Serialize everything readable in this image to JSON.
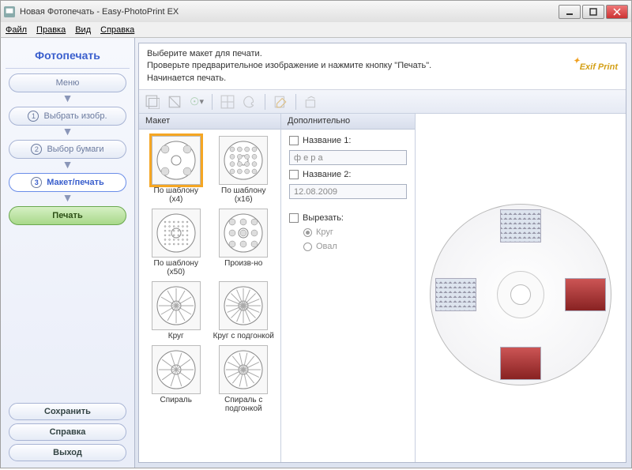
{
  "window": {
    "title": "Новая Фотопечать - Easy-PhotoPrint EX"
  },
  "menu": {
    "file": "Файл",
    "edit": "Правка",
    "view": "Вид",
    "help": "Справка"
  },
  "sidebar": {
    "title": "Фотопечать",
    "steps": {
      "menu": "Меню",
      "select": "Выбрать изобр.",
      "paper": "Выбор бумаги",
      "layout": "Макет/печать"
    },
    "print": "Печать",
    "save": "Сохранить",
    "help": "Справка",
    "exit": "Выход"
  },
  "instructions": {
    "line1": "Выберите макет для печати.",
    "line2": "Проверьте предварительное изображение и нажмите кнопку \"Печать\".",
    "line3": "Начинается печать."
  },
  "brand": "Exif Print",
  "columns": {
    "layout": "Макет",
    "extra": "Дополнительно"
  },
  "layouts": [
    {
      "id": "tmpl4",
      "label": "По шаблону (x4)",
      "selected": true
    },
    {
      "id": "tmpl16",
      "label": "По шаблону (x16)"
    },
    {
      "id": "tmpl50",
      "label": "По шаблону (x50)"
    },
    {
      "id": "free",
      "label": "Произв-но"
    },
    {
      "id": "circle",
      "label": "Круг"
    },
    {
      "id": "circle-fit",
      "label": "Круг с подгонкой"
    },
    {
      "id": "spiral",
      "label": "Спираль"
    },
    {
      "id": "spiral-fit",
      "label": "Спираль с подгонкой"
    }
  ],
  "options": {
    "title1_label": "Название 1:",
    "title1_value": "ф е р а",
    "title2_label": "Название 2:",
    "title2_value": "12.08.2009",
    "crop_label": "Вырезать:",
    "crop_circle": "Круг",
    "crop_oval": "Овал"
  }
}
